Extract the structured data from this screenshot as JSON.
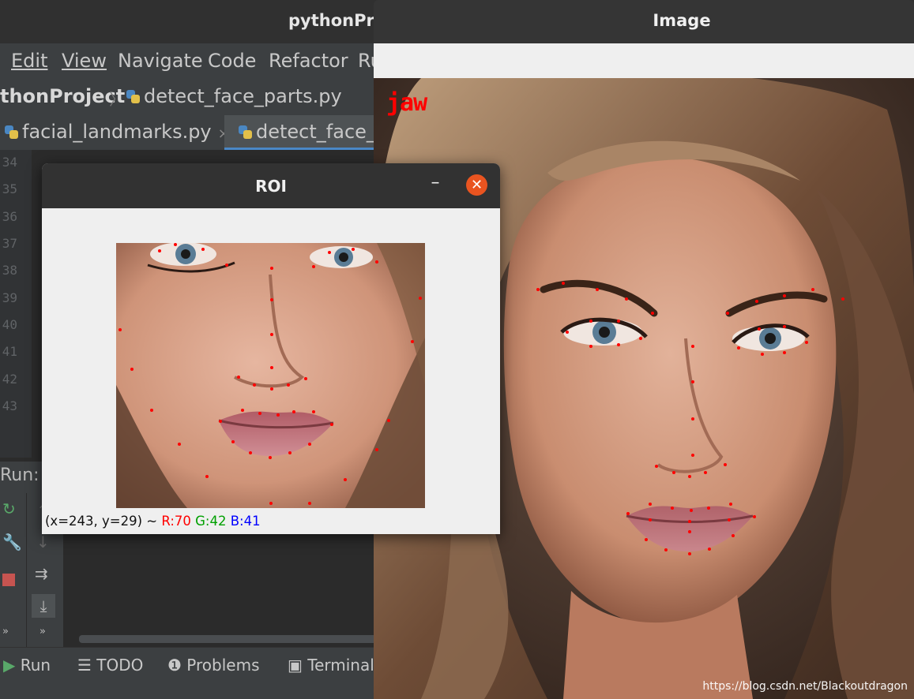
{
  "ide": {
    "window_title": "pythonPro",
    "menu": [
      {
        "label": "Edit"
      },
      {
        "label": "View"
      },
      {
        "label": "Navigate"
      },
      {
        "label": "Code"
      },
      {
        "label": "Refactor"
      },
      {
        "label": "Ru"
      }
    ],
    "breadcrumb": {
      "project": "thonProject",
      "separator": "〉",
      "file": "detect_face_parts.py"
    },
    "tabs": [
      {
        "label": "facial_landmarks.py",
        "close": "×",
        "active": false
      },
      {
        "label": "detect_face_p",
        "active": true
      }
    ],
    "line_numbers": [
      "34",
      "35",
      "36",
      "37",
      "38",
      "39",
      "40",
      "41",
      "42",
      "43"
    ],
    "run_label": "Run:",
    "status_bar": {
      "run": "Run",
      "todo": "TODO",
      "problems": "Problems",
      "terminal": "Terminal"
    },
    "icons": {
      "rerun": "rerun-icon",
      "wrench": "wrench-icon",
      "stop": "stop-icon",
      "soft_wrap": "soft-wrap-icon",
      "scroll_end": "scroll-to-end-icon",
      "more": "»"
    }
  },
  "image_window": {
    "title": "Image",
    "overlay_label": "jaw",
    "watermark": "https://blog.csdn.net/Blackoutdragon"
  },
  "roi_window": {
    "title": "ROI",
    "minimize_symbol": "–",
    "close_symbol": "✕",
    "status": {
      "coords": "(x=243, y=29) ~ ",
      "r": "R:70",
      "g": "G:42",
      "b": "B:41"
    }
  },
  "colors": {
    "landmark": "#ff0000",
    "close_button": "#e95420",
    "ide_background": "#2b2b2b"
  }
}
